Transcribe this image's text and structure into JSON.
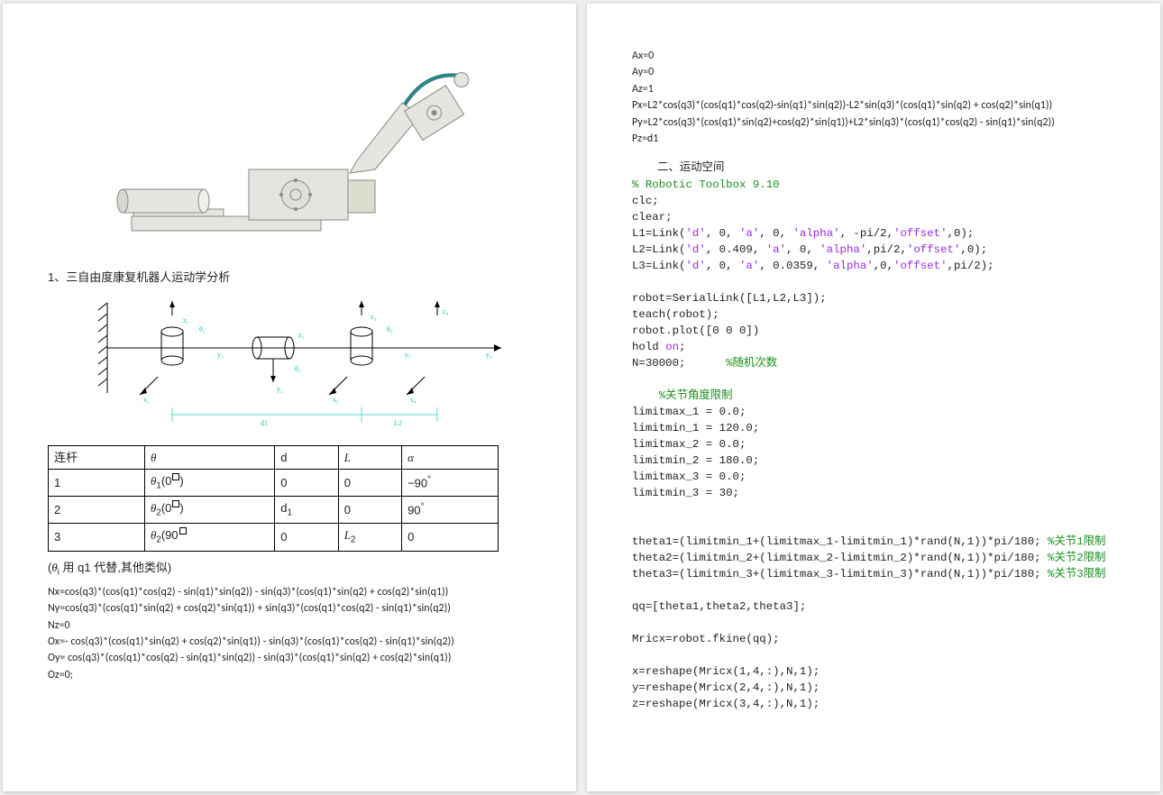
{
  "left_page": {
    "section1_title": "1、三自由度康复机器人运动学分析",
    "dh_table": {
      "headers": [
        "连杆",
        "θ",
        "d",
        "L",
        "α"
      ],
      "rows": [
        {
          "link": "1",
          "theta": "θ₁(0°)",
          "d": "0",
          "L": "0",
          "alpha": "−90°"
        },
        {
          "link": "2",
          "theta": "θ₂(0°)",
          "d": "d₁",
          "L": "0",
          "alpha": "90°"
        },
        {
          "link": "3",
          "theta": "θ₃(90°)",
          "d": "0",
          "L": "L₂",
          "alpha": "0"
        }
      ]
    },
    "note": "(θᵢ 用 q1 代替,其他类似)",
    "formulas": [
      "Nx=cos(q3)*(cos(q1)*cos(q2) - sin(q1)*sin(q2)) - sin(q3)*(cos(q1)*sin(q2) + cos(q2)*sin(q1))",
      "Ny=cos(q3)*(cos(q1)*sin(q2) + cos(q2)*sin(q1)) + sin(q3)*(cos(q1)*cos(q2) - sin(q1)*sin(q2))",
      "Nz=0",
      "Ox=- cos(q3)*(cos(q1)*sin(q2) + cos(q2)*sin(q1)) - sin(q3)*(cos(q1)*cos(q2) - sin(q1)*sin(q2))",
      "Oy= cos(q3)*(cos(q1)*cos(q2) - sin(q1)*sin(q2)) - sin(q3)*(cos(q1)*sin(q2) + cos(q2)*sin(q1))",
      "Oz=0;"
    ]
  },
  "right_page": {
    "top_formulas": [
      "Ax=0",
      "Ay=0",
      "Az=1",
      "Px=L2*cos(q3)*(cos(q1)*cos(q2)-sin(q1)*sin(q2))-L2*sin(q3)*(cos(q1)*sin(q2) + cos(q2)*sin(q1))",
      "Py=L2*cos(q3)*(cos(q1)*sin(q2)+cos(q2)*sin(q1))+L2*sin(q3)*(cos(q1)*cos(q2) - sin(q1)*sin(q2))",
      "Pz=d1"
    ],
    "section2_title": "二、运动空间",
    "code_lines": [
      {
        "segments": [
          {
            "t": "% Robotic Toolbox 9.10",
            "c": "cmt"
          }
        ]
      },
      {
        "segments": [
          {
            "t": "clc;"
          }
        ]
      },
      {
        "segments": [
          {
            "t": "clear;"
          }
        ]
      },
      {
        "segments": [
          {
            "t": "L1=Link("
          },
          {
            "t": "'d'",
            "c": "kw-str"
          },
          {
            "t": ", 0, "
          },
          {
            "t": "'a'",
            "c": "kw-str"
          },
          {
            "t": ", 0, "
          },
          {
            "t": "'alpha'",
            "c": "kw-str"
          },
          {
            "t": ", -pi/2,"
          },
          {
            "t": "'offset'",
            "c": "kw-str"
          },
          {
            "t": ",0);"
          }
        ]
      },
      {
        "segments": [
          {
            "t": "L2=Link("
          },
          {
            "t": "'d'",
            "c": "kw-str"
          },
          {
            "t": ", 0.409, "
          },
          {
            "t": "'a'",
            "c": "kw-str"
          },
          {
            "t": ", 0, "
          },
          {
            "t": "'alpha'",
            "c": "kw-str"
          },
          {
            "t": ",pi/2,"
          },
          {
            "t": "'offset'",
            "c": "kw-str"
          },
          {
            "t": ",0);"
          }
        ]
      },
      {
        "segments": [
          {
            "t": "L3=Link("
          },
          {
            "t": "'d'",
            "c": "kw-str"
          },
          {
            "t": ", 0, "
          },
          {
            "t": "'a'",
            "c": "kw-str"
          },
          {
            "t": ", 0.0359, "
          },
          {
            "t": "'alpha'",
            "c": "kw-str"
          },
          {
            "t": ",0,"
          },
          {
            "t": "'offset'",
            "c": "kw-str"
          },
          {
            "t": ",pi/2);"
          }
        ]
      },
      {
        "segments": [
          {
            "t": ""
          }
        ]
      },
      {
        "segments": [
          {
            "t": "robot=SerialLink([L1,L2,L3]);"
          }
        ]
      },
      {
        "segments": [
          {
            "t": "teach(robot);"
          }
        ]
      },
      {
        "segments": [
          {
            "t": "robot.plot([0 0 0])"
          }
        ]
      },
      {
        "segments": [
          {
            "t": "hold "
          },
          {
            "t": "on",
            "c": "kw-str"
          },
          {
            "t": ";"
          }
        ]
      },
      {
        "segments": [
          {
            "t": "N=30000;      "
          },
          {
            "t": "%随机次数",
            "c": "cmt"
          }
        ]
      },
      {
        "segments": [
          {
            "t": ""
          }
        ]
      },
      {
        "segments": [
          {
            "t": "    "
          },
          {
            "t": "%关节角度限制",
            "c": "cmt"
          }
        ]
      },
      {
        "segments": [
          {
            "t": "limitmax_1 = 0.0;"
          }
        ]
      },
      {
        "segments": [
          {
            "t": "limitmin_1 = 120.0;"
          }
        ]
      },
      {
        "segments": [
          {
            "t": "limitmax_2 = 0.0;"
          }
        ]
      },
      {
        "segments": [
          {
            "t": "limitmin_2 = 180.0;"
          }
        ]
      },
      {
        "segments": [
          {
            "t": "limitmax_3 = 0.0;"
          }
        ]
      },
      {
        "segments": [
          {
            "t": "limitmin_3 = 30;"
          }
        ]
      },
      {
        "segments": [
          {
            "t": ""
          }
        ]
      },
      {
        "segments": [
          {
            "t": ""
          }
        ]
      },
      {
        "segments": [
          {
            "t": "theta1=(limitmin_1+(limitmax_1-limitmin_1)*rand(N,1))*pi/180; "
          },
          {
            "t": "%关节1限制",
            "c": "cmt"
          }
        ]
      },
      {
        "segments": [
          {
            "t": "theta2=(limitmin_2+(limitmax_2-limitmin_2)*rand(N,1))*pi/180; "
          },
          {
            "t": "%关节2限制",
            "c": "cmt"
          }
        ]
      },
      {
        "segments": [
          {
            "t": "theta3=(limitmin_3+(limitmax_3-limitmin_3)*rand(N,1))*pi/180; "
          },
          {
            "t": "%关节3限制",
            "c": "cmt"
          }
        ]
      },
      {
        "segments": [
          {
            "t": ""
          }
        ]
      },
      {
        "segments": [
          {
            "t": "qq=[theta1,theta2,theta3];"
          }
        ]
      },
      {
        "segments": [
          {
            "t": ""
          }
        ]
      },
      {
        "segments": [
          {
            "t": "Mricx=robot.fkine(qq);"
          }
        ]
      },
      {
        "segments": [
          {
            "t": ""
          }
        ]
      },
      {
        "segments": [
          {
            "t": "x=reshape(Mricx(1,4,:),N,1);"
          }
        ]
      },
      {
        "segments": [
          {
            "t": "y=reshape(Mricx(2,4,:),N,1);"
          }
        ]
      },
      {
        "segments": [
          {
            "t": "z=reshape(Mricx(3,4,:),N,1);"
          }
        ]
      }
    ]
  }
}
